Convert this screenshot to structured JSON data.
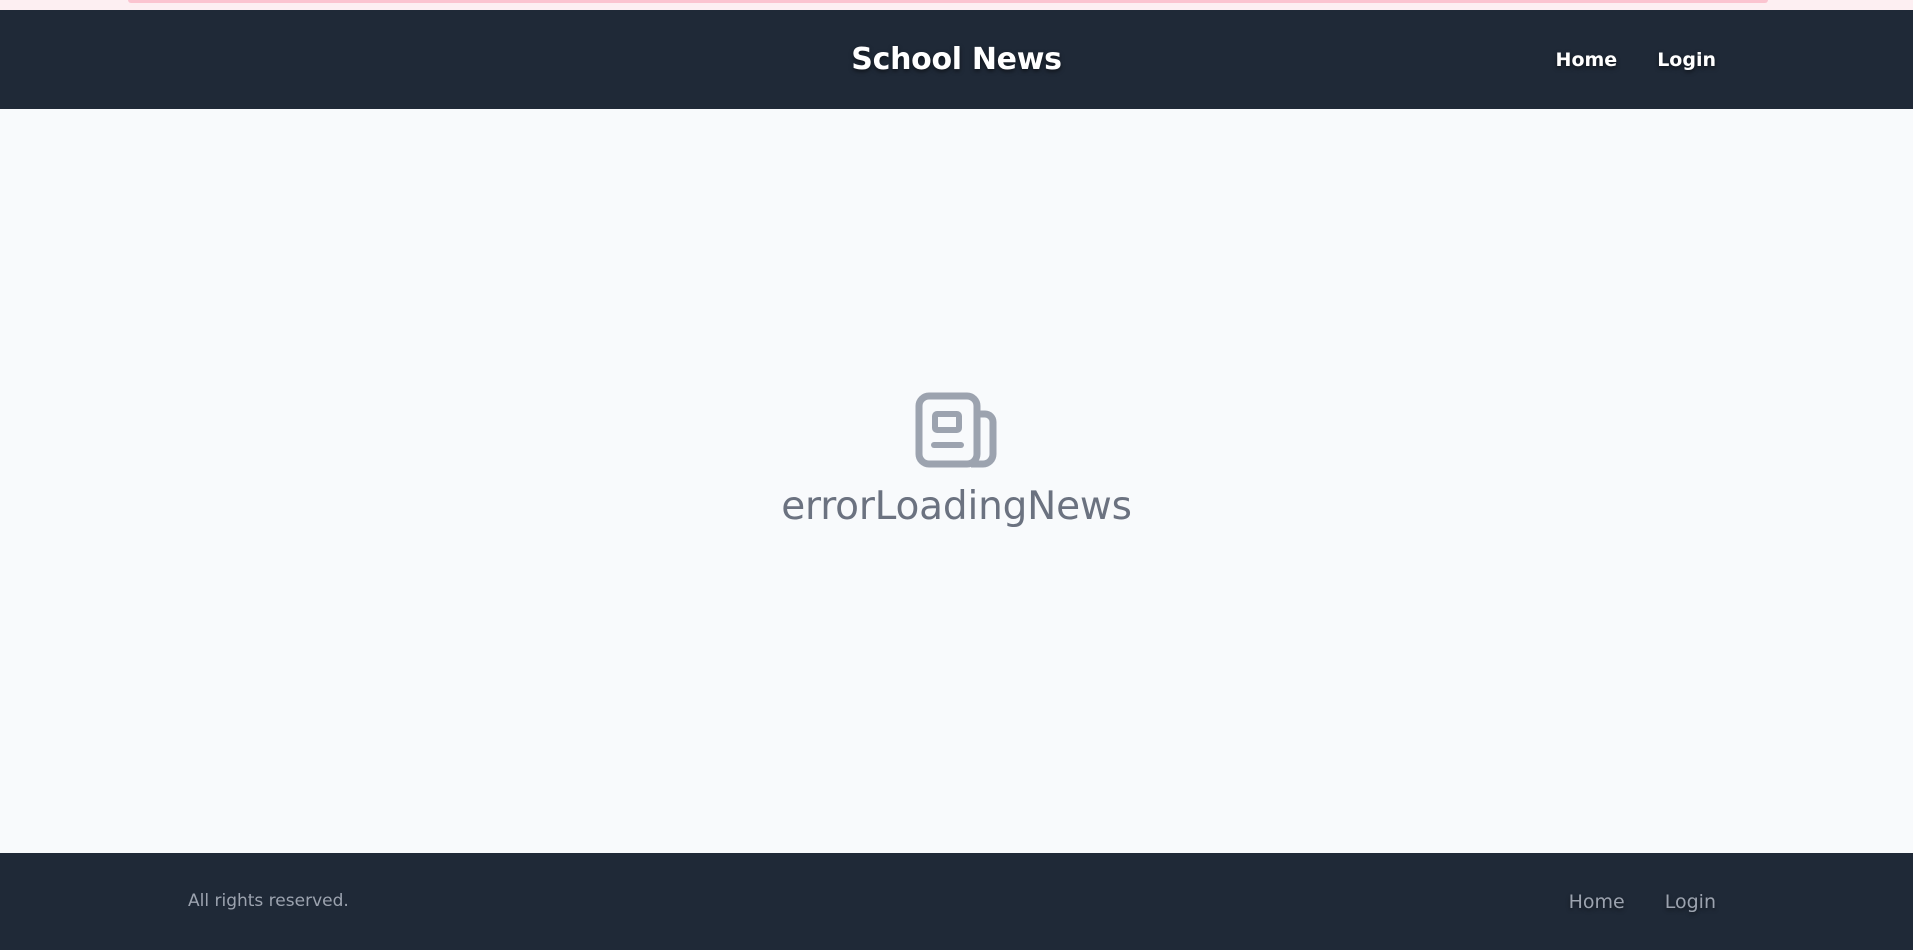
{
  "header": {
    "title": "School News",
    "nav": {
      "home": "Home",
      "login": "Login"
    }
  },
  "main": {
    "icon": "newspaper-icon",
    "message": "errorLoadingNews"
  },
  "footer": {
    "copyright": "All rights reserved.",
    "nav": {
      "home": "Home",
      "login": "Login"
    }
  },
  "colors": {
    "header_bg": "#1f2937",
    "page_bg": "#f8fafc",
    "icon": "#9ca3af",
    "message_text": "#6b7280",
    "footer_text": "#9ca3af",
    "top_strip": "#fbc4d0"
  }
}
